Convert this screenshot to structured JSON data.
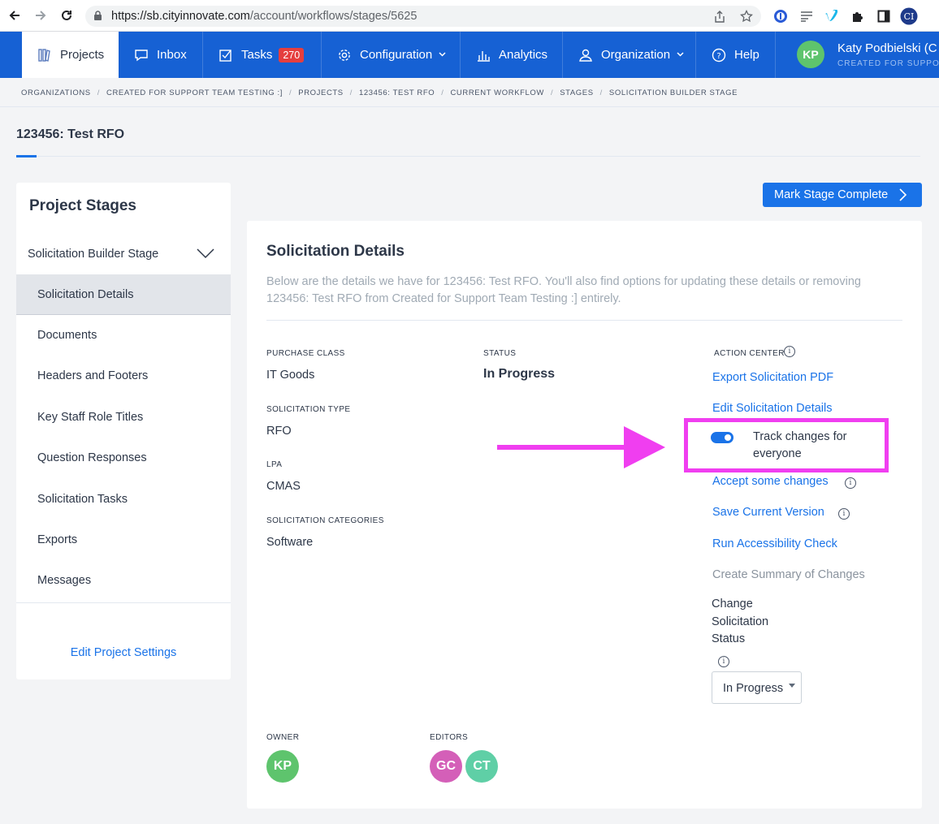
{
  "browser": {
    "url_host": "https://sb.cityinnovate.com",
    "url_path": "/account/workflows/stages/5625"
  },
  "nav": {
    "projects": "Projects",
    "inbox": "Inbox",
    "tasks": "Tasks",
    "tasks_count": "270",
    "configuration": "Configuration",
    "analytics": "Analytics",
    "organization": "Organization",
    "help": "Help",
    "user_initials": "KP",
    "user_name": "Katy Podbielski (C",
    "user_org": "CREATED FOR SUPPOR"
  },
  "breadcrumb": [
    "ORGANIZATIONS",
    "CREATED FOR SUPPORT TEAM TESTING :]",
    "PROJECTS",
    "123456: TEST RFO",
    "CURRENT WORKFLOW",
    "STAGES",
    "SOLICITATION BUILDER STAGE"
  ],
  "page_title": "123456: Test RFO",
  "sidebar": {
    "title": "Project Stages",
    "stage": "Solicitation Builder Stage",
    "items": [
      "Solicitation Details",
      "Documents",
      "Headers and Footers",
      "Key Staff Role Titles",
      "Question Responses",
      "Solicitation Tasks",
      "Exports",
      "Messages"
    ],
    "selected": "Solicitation Details",
    "edit_link": "Edit Project Settings"
  },
  "mark_complete_label": "Mark Stage Complete",
  "details": {
    "title": "Solicitation Details",
    "description": "Below are the details we have for 123456: Test RFO. You'll also find options for updating these details or removing 123456: Test RFO from Created for Support Team Testing :] entirely.",
    "purchase_class_label": "PURCHASE CLASS",
    "purchase_class": "IT Goods",
    "status_label": "STATUS",
    "status": "In Progress",
    "solicitation_type_label": "SOLICITATION TYPE",
    "solicitation_type": "RFO",
    "lpa_label": "LPA",
    "lpa": "CMAS",
    "categories_label": "SOLICITATION CATEGORIES",
    "categories": "Software",
    "owner_label": "OWNER",
    "owner": "KP",
    "editors_label": "EDITORS",
    "editors": [
      "GC",
      "CT"
    ]
  },
  "action_center": {
    "label": "ACTION CENTER",
    "export_pdf": "Export Solicitation PDF",
    "edit_details": "Edit Solicitation Details",
    "track_changes": "Track changes for everyone",
    "track_changes_on": true,
    "accept_changes": "Accept some changes",
    "save_version": "Save Current Version",
    "accessibility": "Run Accessibility Check",
    "summary": "Create Summary of Changes",
    "change_status_words": [
      "Change",
      "Solicitation",
      "Status"
    ],
    "status_select": "In Progress"
  },
  "colors": {
    "nav": "#1661d4",
    "link": "#1a73e8",
    "highlight": "#f03ef0",
    "owner_avatar": "#5ec46d",
    "editor_gc": "#d45fb8",
    "editor_ct": "#5fcfa6"
  }
}
